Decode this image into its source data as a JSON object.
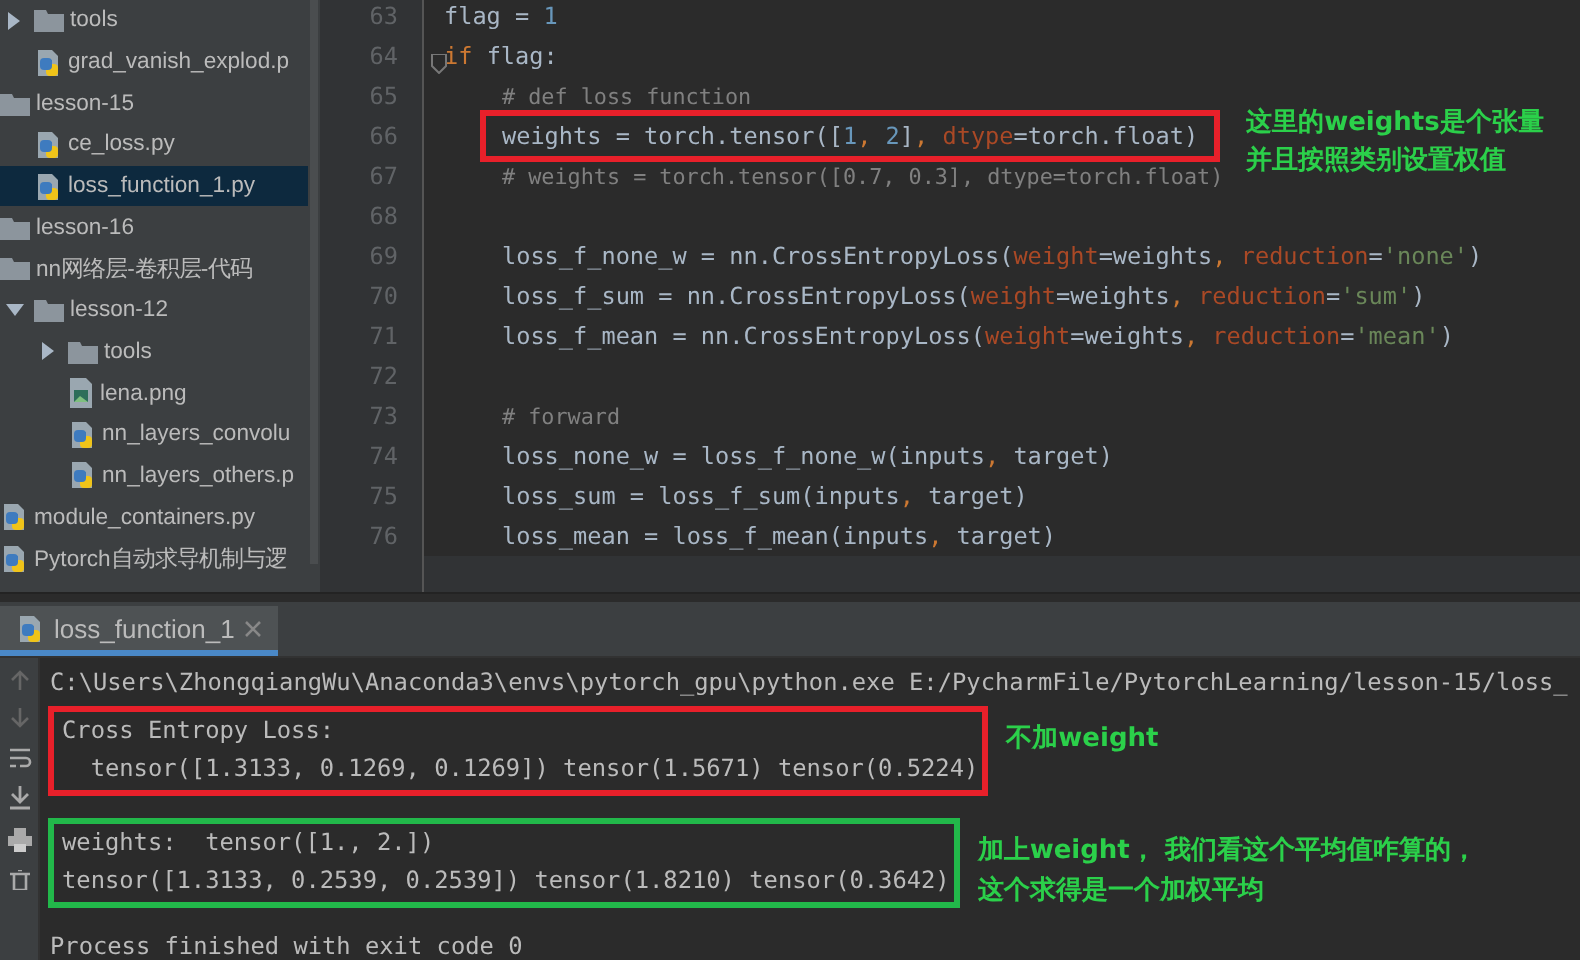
{
  "project_tree": {
    "continued": [
      {
        "label": "tools",
        "kind": "folder",
        "expanded": false,
        "selected": false
      },
      {
        "label": "grad_vanish_explod.p",
        "kind": "python",
        "selected": false
      }
    ],
    "items": [
      {
        "label": "lesson-15",
        "kind": "folder",
        "selected": false,
        "children": [
          {
            "label": "ce_loss.py",
            "kind": "python",
            "selected": false
          },
          {
            "label": "loss_function_1.py",
            "kind": "python",
            "selected": true
          }
        ]
      },
      {
        "label": "lesson-16",
        "kind": "folder",
        "selected": false
      },
      {
        "label": "nn网络层-卷积层-代码",
        "kind": "folder",
        "selected": false,
        "children": [
          {
            "label": "lesson-12",
            "kind": "folder",
            "expanded": true,
            "selected": false,
            "children": [
              {
                "label": "tools",
                "kind": "folder",
                "expanded": false,
                "selected": false
              },
              {
                "label": "lena.png",
                "kind": "image",
                "selected": false
              },
              {
                "label": "nn_layers_convolu",
                "kind": "python",
                "selected": false
              },
              {
                "label": "nn_layers_others.p",
                "kind": "python",
                "selected": false
              }
            ]
          }
        ]
      },
      {
        "label": "module_containers.py",
        "kind": "python",
        "selected": false
      },
      {
        "label": "Pytorch自动求导机制与逻",
        "kind": "python",
        "selected": false
      }
    ]
  },
  "editor": {
    "lines": [
      {
        "number": "63",
        "tokens": [
          {
            "kind": "plain",
            "text": "flag = "
          },
          {
            "kind": "number",
            "text": "1"
          }
        ]
      },
      {
        "number": "64",
        "tokens": [
          {
            "kind": "keyword",
            "text": "if"
          },
          {
            "kind": "plain",
            "text": " flag:"
          }
        ],
        "children": [
          {
            "number": "65",
            "tokens": [
              {
                "kind": "comment",
                "text": "# def loss function"
              }
            ]
          },
          {
            "number": "66",
            "highlight": {
              "color": "#e8202a",
              "note_lines": [
                "这里的weights是个张量",
                "并且按照类别设置权值"
              ]
            },
            "tokens": [
              {
                "kind": "plain",
                "text": "weights = torch.tensor(["
              },
              {
                "kind": "number",
                "text": "1"
              },
              {
                "kind": "keyword",
                "text": ", "
              },
              {
                "kind": "number",
                "text": "2"
              },
              {
                "kind": "plain",
                "text": "]"
              },
              {
                "kind": "keyword",
                "text": ", "
              },
              {
                "kind": "param",
                "text": "dtype"
              },
              {
                "kind": "plain",
                "text": "=torch.float)"
              }
            ]
          },
          {
            "number": "67",
            "tokens": [
              {
                "kind": "comment",
                "text": "# weights = torch.tensor([0.7, 0.3], dtype=torch.float)"
              }
            ]
          },
          {
            "number": "68"
          },
          {
            "number": "69",
            "tokens": [
              {
                "kind": "plain",
                "text": "loss_f_none_w = nn.CrossEntropyLoss("
              },
              {
                "kind": "param",
                "text": "weight"
              },
              {
                "kind": "plain",
                "text": "=weights"
              },
              {
                "kind": "keyword",
                "text": ", "
              },
              {
                "kind": "param",
                "text": "reduction"
              },
              {
                "kind": "plain",
                "text": "="
              },
              {
                "kind": "string",
                "text": "'none'"
              },
              {
                "kind": "plain",
                "text": ")"
              }
            ]
          },
          {
            "number": "70",
            "tokens": [
              {
                "kind": "plain",
                "text": "loss_f_sum = nn.CrossEntropyLoss("
              },
              {
                "kind": "param",
                "text": "weight"
              },
              {
                "kind": "plain",
                "text": "=weights"
              },
              {
                "kind": "keyword",
                "text": ", "
              },
              {
                "kind": "param",
                "text": "reduction"
              },
              {
                "kind": "plain",
                "text": "="
              },
              {
                "kind": "string",
                "text": "'sum'"
              },
              {
                "kind": "plain",
                "text": ")"
              }
            ]
          },
          {
            "number": "71",
            "tokens": [
              {
                "kind": "plain",
                "text": "loss_f_mean = nn.CrossEntropyLoss("
              },
              {
                "kind": "param",
                "text": "weight"
              },
              {
                "kind": "plain",
                "text": "=weights"
              },
              {
                "kind": "keyword",
                "text": ", "
              },
              {
                "kind": "param",
                "text": "reduction"
              },
              {
                "kind": "plain",
                "text": "="
              },
              {
                "kind": "string",
                "text": "'mean'"
              },
              {
                "kind": "plain",
                "text": ")"
              }
            ]
          },
          {
            "number": "72"
          },
          {
            "number": "73",
            "tokens": [
              {
                "kind": "comment",
                "text": "# forward"
              }
            ]
          },
          {
            "number": "74",
            "tokens": [
              {
                "kind": "plain",
                "text": "loss_none_w = loss_f_none_w(inputs"
              },
              {
                "kind": "keyword",
                "text": ", "
              },
              {
                "kind": "plain",
                "text": "target)"
              }
            ]
          },
          {
            "number": "75",
            "tokens": [
              {
                "kind": "plain",
                "text": "loss_sum = loss_f_sum(inputs"
              },
              {
                "kind": "keyword",
                "text": ", "
              },
              {
                "kind": "plain",
                "text": "target)"
              }
            ]
          },
          {
            "number": "76",
            "tokens": [
              {
                "kind": "plain",
                "text": "loss_mean = loss_f_mean(inputs"
              },
              {
                "kind": "keyword",
                "text": ", "
              },
              {
                "kind": "plain",
                "text": "target)"
              }
            ]
          }
        ]
      }
    ]
  },
  "run_panel": {
    "tab": {
      "label": "loss_function_1",
      "selected": true
    },
    "console": [
      {
        "lines": [
          "C:\\Users\\ZhongqiangWu\\Anaconda3\\envs\\pytorch_gpu\\python.exe E:/PycharmFile/PytorchLearning/lesson-15/loss_"
        ]
      },
      {
        "box": {
          "color": "#e8202a",
          "note_lines": [
            "不加weight"
          ]
        },
        "lines": [
          "Cross Entropy Loss:",
          "  tensor([1.3133, 0.1269, 0.1269]) tensor(1.5671) tensor(0.5224)"
        ]
      },
      {
        "box": {
          "color": "#22b84a",
          "note_lines": [
            "加上weight， 我们看这个平均值咋算的，",
            "这个求得是一个加权平均"
          ]
        },
        "lines": [
          "weights:  tensor([1., 2.])",
          "tensor([1.3133, 0.2539, 0.2539]) tensor(1.8210) tensor(0.3642)"
        ]
      },
      {
        "lines": [
          "Process finished with exit code 0"
        ]
      }
    ]
  }
}
